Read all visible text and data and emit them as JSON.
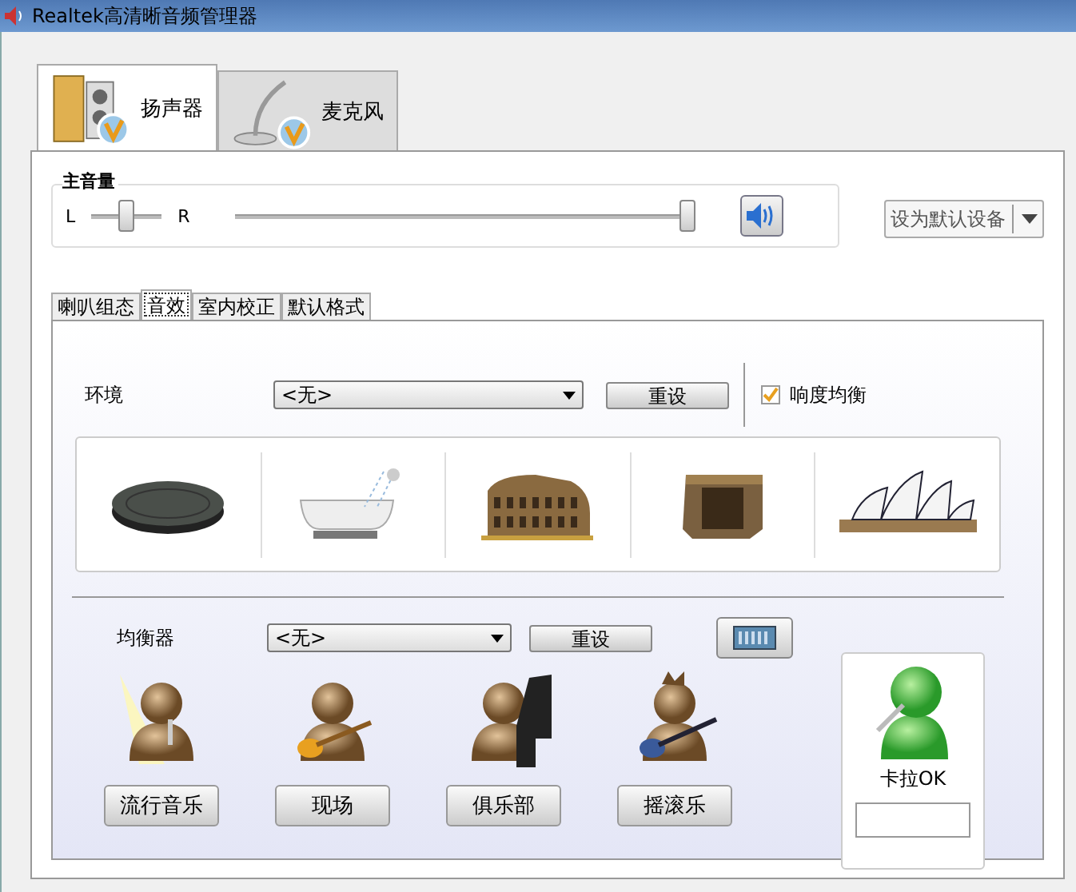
{
  "window": {
    "title": "Realtek高清晰音频管理器"
  },
  "device_tabs": [
    {
      "label": "扬声器",
      "kind": "speaker",
      "selected": true
    },
    {
      "label": "麦克风",
      "kind": "microphone",
      "selected": false
    }
  ],
  "main_volume": {
    "label": "主音量",
    "left_label": "L",
    "right_label": "R",
    "balance": {
      "level": 0.5
    },
    "volume": {
      "level": 1.0
    }
  },
  "default_device_button": "设为默认设备",
  "sub_tabs": [
    {
      "label": "喇叭组态",
      "selected": false
    },
    {
      "label": "音效",
      "selected": true
    },
    {
      "label": "室内校正",
      "selected": false
    },
    {
      "label": "默认格式",
      "selected": false
    }
  ],
  "environment": {
    "label": "环境",
    "value": "<无>",
    "reset_button": "重设",
    "loudness": {
      "label": "响度均衡",
      "checked": true
    }
  },
  "equalizer": {
    "label": "均衡器",
    "value": "<无>",
    "reset_button": "重设",
    "presets": [
      {
        "label": "流行音乐",
        "kind": "pop"
      },
      {
        "label": "现场",
        "kind": "live"
      },
      {
        "label": "俱乐部",
        "kind": "club"
      },
      {
        "label": "摇滚乐",
        "kind": "rock"
      }
    ]
  },
  "karaoke": {
    "label": "卡拉OK"
  }
}
